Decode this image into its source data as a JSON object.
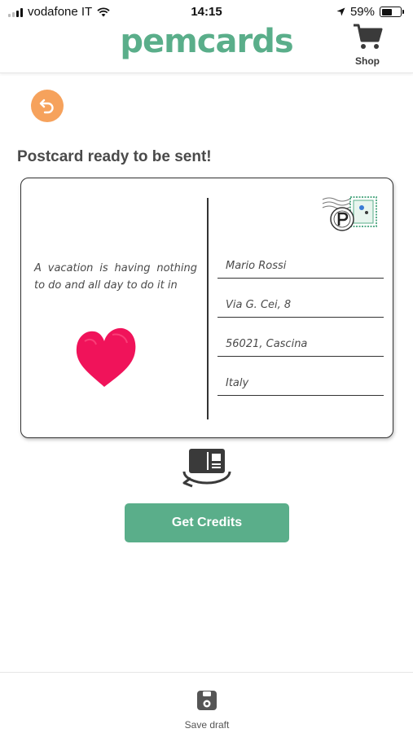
{
  "status_bar": {
    "carrier": "vodafone IT",
    "time": "14:15",
    "battery": "59%",
    "battery_level": 0.59,
    "icons": [
      "signal-icon",
      "wifi-icon",
      "location-arrow-icon",
      "battery-icon"
    ]
  },
  "header": {
    "logo": "pemcards",
    "shop_label": "Shop",
    "shop_icon": "cart-icon"
  },
  "back_icon": "back-arrow-icon",
  "page_title": "Postcard ready to be sent!",
  "postcard": {
    "message": "A vacation is having nothing to do and all day to do it in",
    "stamp_icon": "postage-stamp-icon",
    "heart_icon": "heart-icon",
    "address": {
      "name": "Mario Rossi",
      "street": "Via G. Cei, 8",
      "city": "56021, Cascina",
      "country": "Italy"
    }
  },
  "flip_icon": "flip-card-icon",
  "get_credits_label": "Get Credits",
  "bottom_bar": {
    "save_draft_label": "Save draft",
    "save_icon": "clipboard-save-icon"
  },
  "colors": {
    "brand_green": "#5aae8a",
    "back_orange": "#f6a25c",
    "heart_red": "#f0135a"
  }
}
